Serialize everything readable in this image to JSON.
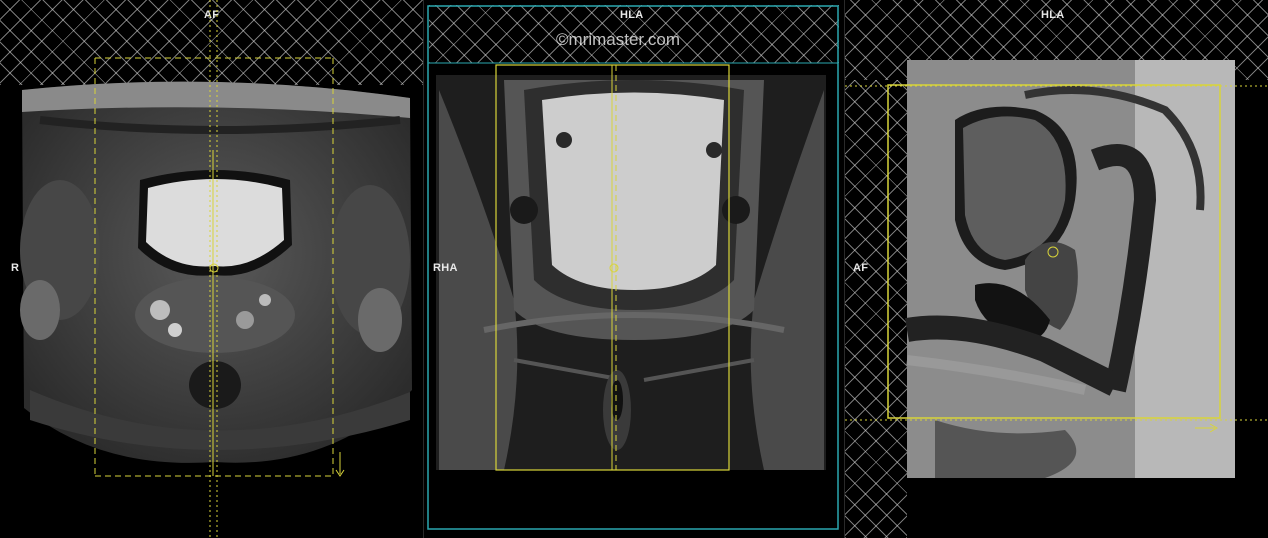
{
  "left_view": {
    "orientation_top": "AF",
    "orientation_left": "R"
  },
  "middle_view": {
    "orientation_top": "HLA",
    "orientation_left": "RHA",
    "watermark": "©mrimaster.com"
  },
  "right_view": {
    "orientation_top": "HLA",
    "orientation_left": "AF"
  },
  "colors": {
    "planning_box": "#d8d43a",
    "selected_viewport_border": "#2aa7b0",
    "background": "#000000"
  }
}
